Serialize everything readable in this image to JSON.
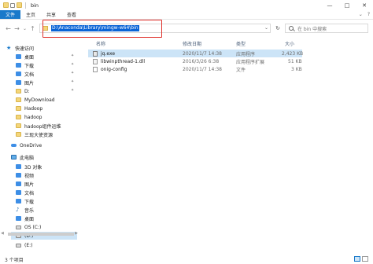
{
  "window": {
    "title": "bin",
    "minimize": "—",
    "maximize": "□",
    "close": "✕"
  },
  "ribbon": {
    "tabs": [
      "文件",
      "主页",
      "共享",
      "查看"
    ],
    "expand": "⌄",
    "help": "?"
  },
  "address": {
    "back": "←",
    "forward": "→",
    "recent": "⌄",
    "up": "↑",
    "path": "D:\\Anaconda\\Library\\mingw-w64\\bin",
    "refresh": "↻",
    "search_placeholder": "在 bin 中搜索"
  },
  "sidebar": {
    "items": [
      {
        "label": "快速访问",
        "icon": "star-icon",
        "pinned": false
      },
      {
        "label": "桌面",
        "icon": "desktop-icon",
        "pinned": true
      },
      {
        "label": "下载",
        "icon": "download-icon",
        "pinned": true
      },
      {
        "label": "文档",
        "icon": "document-icon",
        "pinned": true
      },
      {
        "label": "图片",
        "icon": "picture-icon",
        "pinned": true
      },
      {
        "label": "D:",
        "icon": "folder-icon",
        "pinned": true
      },
      {
        "label": "MyDownload",
        "icon": "folder-icon",
        "pinned": false
      },
      {
        "label": "Hadoop",
        "icon": "folder-icon",
        "pinned": false
      },
      {
        "label": "hadoop",
        "icon": "folder-icon",
        "pinned": false
      },
      {
        "label": "hadoop组件运维",
        "icon": "folder-icon",
        "pinned": false
      },
      {
        "label": "三现大使资源",
        "icon": "folder-icon",
        "pinned": false
      },
      {
        "label": "OneDrive",
        "icon": "cloud-icon",
        "pinned": false
      },
      {
        "label": "此电脑",
        "icon": "pc-icon",
        "pinned": false
      },
      {
        "label": "3D 对象",
        "icon": "3d-objects-icon",
        "pinned": false
      },
      {
        "label": "视频",
        "icon": "video-icon",
        "pinned": false
      },
      {
        "label": "图片",
        "icon": "picture-icon",
        "pinned": false
      },
      {
        "label": "文档",
        "icon": "document-icon",
        "pinned": false
      },
      {
        "label": "下载",
        "icon": "download-icon",
        "pinned": false
      },
      {
        "label": "音乐",
        "icon": "music-icon",
        "pinned": false
      },
      {
        "label": "桌面",
        "icon": "desktop-icon",
        "pinned": false
      },
      {
        "label": "OS (C:)",
        "icon": "drive-icon",
        "pinned": false
      },
      {
        "label": "(D:)",
        "icon": "drive-icon",
        "pinned": false,
        "selected": true
      },
      {
        "label": "(E:)",
        "icon": "drive-icon",
        "pinned": false
      }
    ]
  },
  "columns": {
    "name": "名称",
    "date": "修改日期",
    "type": "类型",
    "size": "大小"
  },
  "files": [
    {
      "name": "jq.exe",
      "date": "2020/11/7 14:38",
      "type": "应用程序",
      "size": "2,423 KB",
      "icon": "exe-file-icon",
      "selected": true
    },
    {
      "name": "libwinpthread-1.dll",
      "date": "2016/3/26 6:38",
      "type": "应用程序扩展",
      "size": "51 KB",
      "icon": "dll-file-icon",
      "selected": false
    },
    {
      "name": "onig-config",
      "date": "2020/11/7 14:38",
      "type": "文件",
      "size": "3 KB",
      "icon": "generic-file-icon",
      "selected": false
    }
  ],
  "status": {
    "text": "3 个项目"
  },
  "colors": {
    "accent": "#1979ca",
    "selection": "#cce4f7",
    "highlight_box": "#e0302b"
  }
}
